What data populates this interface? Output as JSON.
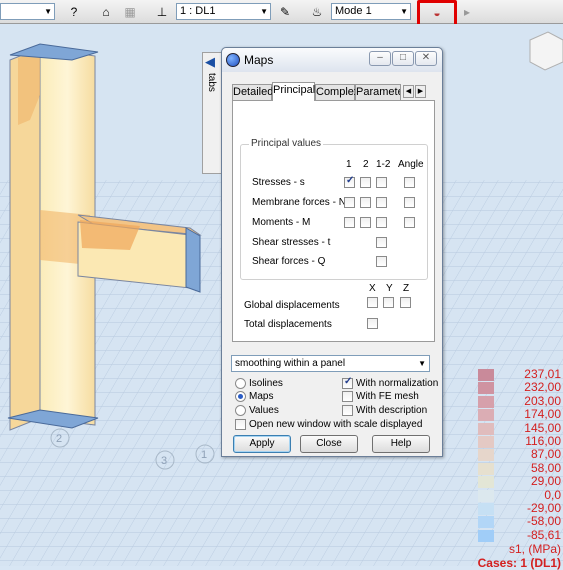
{
  "toolbar": {
    "load_case": "1 : DL1",
    "mode": "Mode  1"
  },
  "tabs_strip": {
    "label": "tabs"
  },
  "dialog": {
    "title": "Maps",
    "tabs": [
      "Detailed",
      "Principal",
      "Complex",
      "Parameter"
    ],
    "active_tab": "Principal",
    "principal": {
      "group_title": "Principal values",
      "columns": [
        "1",
        "2",
        "1-2",
        "Angle"
      ],
      "rows": [
        {
          "label": "Stresses - s",
          "checks": [
            true,
            false,
            false,
            false
          ]
        },
        {
          "label": "Membrane forces - N",
          "checks": [
            false,
            false,
            false,
            false
          ]
        },
        {
          "label": "Moments - M",
          "checks": [
            false,
            false,
            false,
            false
          ]
        },
        {
          "label": "Shear stresses - t",
          "checks": [
            false
          ]
        },
        {
          "label": "Shear forces - Q",
          "checks": [
            false
          ]
        }
      ],
      "disp_columns": [
        "X",
        "Y",
        "Z"
      ],
      "global_displacements": "Global displacements",
      "total_displacements": "Total displacements"
    },
    "smoothing": "smoothing within a panel",
    "options": {
      "isolines": "Isolines",
      "maps": "Maps",
      "values": "Values",
      "selected_display": "Maps",
      "with_normalization": "With normalization",
      "with_fe_mesh": "With FE mesh",
      "with_description": "With description",
      "open_new_window": "Open new window with scale displayed",
      "normalization_checked": true
    },
    "buttons": {
      "apply": "Apply",
      "close": "Close",
      "help": "Help"
    }
  },
  "legend": {
    "values": [
      "237,01",
      "232,00",
      "203,00",
      "174,00",
      "145,00",
      "116,00",
      "87,00",
      "58,00",
      "29,00",
      "0,0",
      "-29,00",
      "-58,00",
      "-85,61"
    ],
    "colors": [
      "#c98a9a",
      "#cf93a1",
      "#d6a0ab",
      "#dbadb4",
      "#e0bcbd",
      "#e4c9c4",
      "#e6d6cb",
      "#e6e0cf",
      "#e3e6d6",
      "#dce8ee",
      "#c6e0f4",
      "#b2d6f7",
      "#a0cdf8"
    ],
    "unit": "s1, (MPa)",
    "cases": "Cases: 1 (DL1)"
  },
  "scene": {
    "node_labels": [
      "2",
      "3",
      "1"
    ]
  }
}
